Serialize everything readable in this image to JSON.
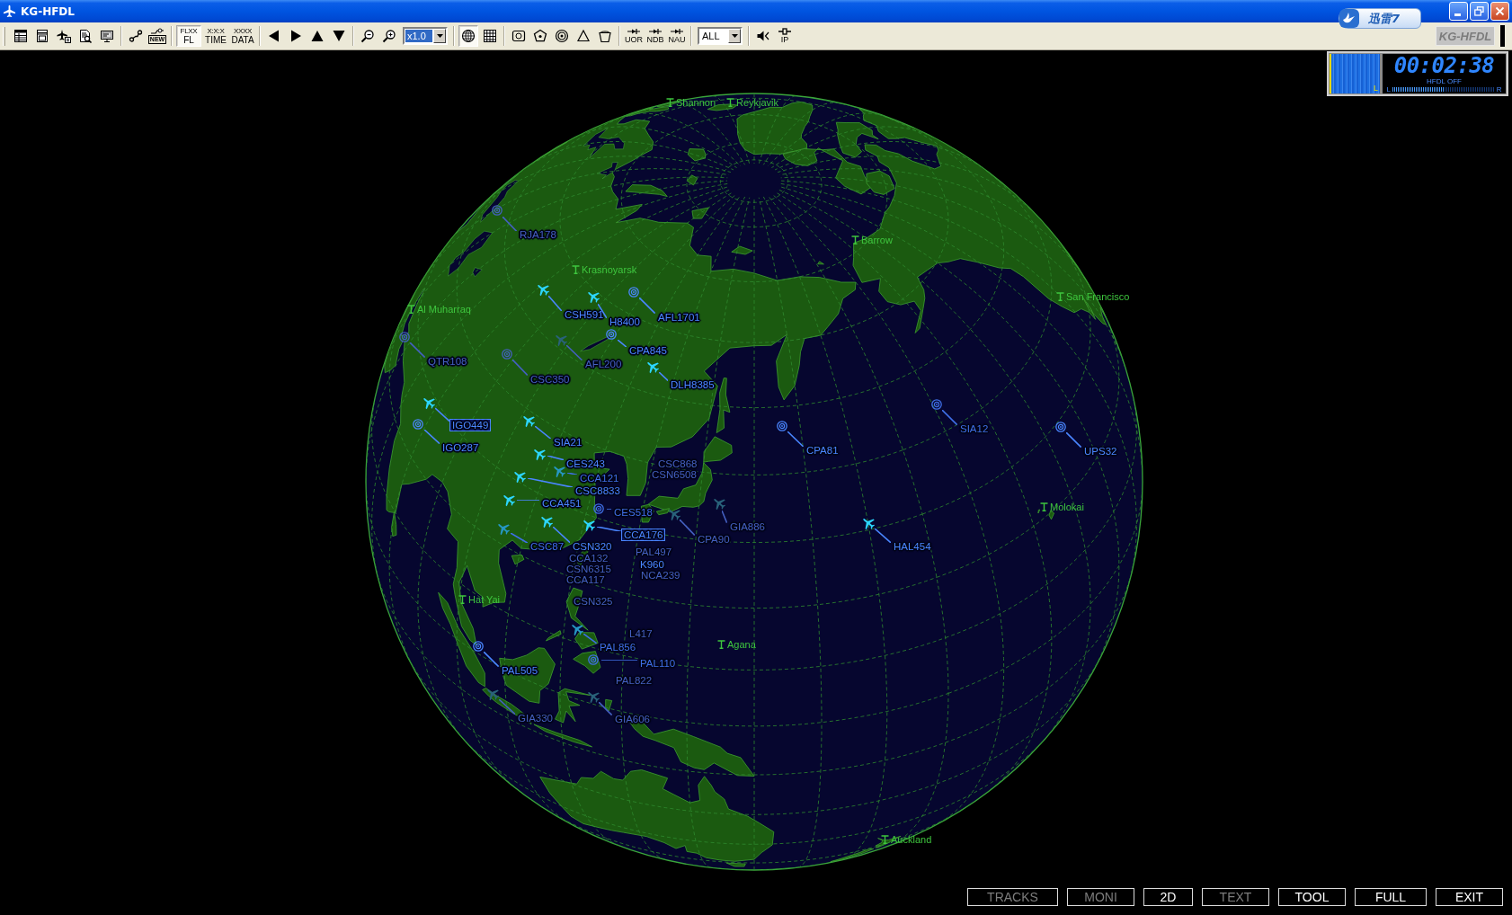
{
  "window": {
    "title": "KG-HFDL"
  },
  "floating_widget": {
    "label": "迅雷7"
  },
  "toolbar": {
    "groups": [
      [
        {
          "kind": "table",
          "pressed": false
        },
        {
          "kind": "window",
          "pressed": false
        },
        {
          "kind": "plane-doc",
          "pressed": false
        },
        {
          "kind": "doc-search",
          "pressed": false
        },
        {
          "kind": "monitor",
          "pressed": false
        }
      ],
      [
        {
          "kind": "connector",
          "pressed": false
        },
        {
          "kind": "new",
          "label": "NEW",
          "pressed": false
        }
      ],
      [
        {
          "kind": "readout",
          "caption": "FLXX",
          "label": "FL",
          "pressed": true
        },
        {
          "kind": "readout",
          "caption": "X:X:X",
          "label": "TIME",
          "pressed": false
        },
        {
          "kind": "readout",
          "caption": "XXXX",
          "label": "DATA",
          "pressed": false
        }
      ],
      [
        {
          "kind": "left",
          "pressed": false
        },
        {
          "kind": "right",
          "pressed": false
        },
        {
          "kind": "up",
          "pressed": false
        },
        {
          "kind": "down",
          "pressed": false
        }
      ],
      [
        {
          "kind": "zoom-out",
          "pressed": false
        },
        {
          "kind": "zoom-in",
          "pressed": false
        },
        {
          "kind": "select",
          "value": "x1.0",
          "focused": true
        }
      ],
      [
        {
          "kind": "globe",
          "pressed": true
        },
        {
          "kind": "grid",
          "pressed": false
        }
      ],
      [
        {
          "kind": "frame",
          "pressed": false
        },
        {
          "kind": "pentagon",
          "pressed": false
        },
        {
          "kind": "rings",
          "pressed": false
        },
        {
          "kind": "triangle",
          "pressed": false
        },
        {
          "kind": "bucket",
          "pressed": false
        }
      ],
      [
        {
          "kind": "beacon",
          "label": "UOR",
          "pressed": false
        },
        {
          "kind": "beacon",
          "label": "NDB",
          "pressed": false
        },
        {
          "kind": "beacon",
          "label": "NAU",
          "pressed": false
        }
      ],
      [
        {
          "kind": "select",
          "value": "ALL",
          "focused": false
        }
      ],
      [
        {
          "kind": "speaker",
          "pressed": false
        },
        {
          "kind": "pin",
          "label": "IP",
          "pressed": false
        }
      ]
    ],
    "logo": "KG-HFDL"
  },
  "receiver": {
    "channel": "L",
    "clock": "00:02:38",
    "status": "HFDL OFF",
    "meter_left": "L",
    "meter_right": "R",
    "level": 0.5
  },
  "map": {
    "stations": [
      {
        "name": "Shannon"
      },
      {
        "name": "Reykjavik"
      },
      {
        "name": "Barrow"
      },
      {
        "name": "San Francisco"
      },
      {
        "name": "Al Muharraq"
      },
      {
        "name": "Krasnoyarsk"
      },
      {
        "name": "Hat Yai"
      },
      {
        "name": "Agana"
      },
      {
        "name": "Molokai"
      },
      {
        "name": "Auckland"
      }
    ],
    "flights": [
      {
        "callsign": "RJA178",
        "kind": "target",
        "color": "#4460c0",
        "boxed": false
      },
      {
        "callsign": "QTR108",
        "kind": "target",
        "color": "#4460c0",
        "boxed": false
      },
      {
        "callsign": "CSH591",
        "kind": "plane",
        "color": "#4a86ff",
        "boxed": false
      },
      {
        "callsign": "H8400",
        "kind": "plane",
        "color": "#4a86ff",
        "boxed": false
      },
      {
        "callsign": "AFL1701",
        "kind": "target",
        "color": "#4a86ff",
        "boxed": false
      },
      {
        "callsign": "CPA845",
        "kind": "target",
        "color": "#4a86ff",
        "boxed": false
      },
      {
        "callsign": "AFL200",
        "kind": "plane",
        "color": "#4460c0",
        "boxed": false
      },
      {
        "callsign": "CSC350",
        "kind": "target",
        "color": "#4460c0",
        "boxed": false
      },
      {
        "callsign": "DLH8385",
        "kind": "plane",
        "color": "#4a86ff",
        "boxed": false
      },
      {
        "callsign": "IGO449",
        "kind": "plane",
        "color": "#4a86ff",
        "boxed": true
      },
      {
        "callsign": "IGO287",
        "kind": "target",
        "color": "#4a86ff",
        "boxed": false
      },
      {
        "callsign": "SIA21",
        "kind": "plane",
        "color": "#4a86ff",
        "boxed": false
      },
      {
        "callsign": "CES243",
        "kind": "plane",
        "color": "#4a86ff",
        "boxed": false
      },
      {
        "callsign": "CCA121",
        "kind": "plane",
        "color": "#3f6fe6",
        "boxed": false
      },
      {
        "callsign": "CSC8833",
        "kind": "plane",
        "color": "#4a86ff",
        "boxed": false
      },
      {
        "callsign": "CCA451",
        "kind": "plane",
        "color": "#4a86ff",
        "boxed": false
      },
      {
        "callsign": "CES518",
        "kind": "target",
        "color": "#3f6fe6",
        "boxed": false
      },
      {
        "callsign": "CCA176",
        "kind": "plane",
        "color": "#4a86ff",
        "boxed": true
      },
      {
        "callsign": "CSC87",
        "kind": "plane",
        "color": "#3f6fe6",
        "boxed": false
      },
      {
        "callsign": "CSN320",
        "kind": "plane",
        "color": "#4a86ff",
        "boxed": false
      },
      {
        "callsign": "PAL497",
        "kind": "tag",
        "color": "#4460c0",
        "boxed": false
      },
      {
        "callsign": "CCA132",
        "kind": "tag",
        "color": "#4460c0",
        "boxed": false
      },
      {
        "callsign": "K960",
        "kind": "tag",
        "color": "#4a86ff",
        "boxed": false
      },
      {
        "callsign": "CSN6315",
        "kind": "tag",
        "color": "#4460c0",
        "boxed": false
      },
      {
        "callsign": "NCA239",
        "kind": "tag",
        "color": "#4460c0",
        "boxed": false
      },
      {
        "callsign": "CCA117",
        "kind": "tag",
        "color": "#4460c0",
        "boxed": false
      },
      {
        "callsign": "CSC868",
        "kind": "tag",
        "color": "#4460c0",
        "boxed": false
      },
      {
        "callsign": "CSN6508",
        "kind": "tag",
        "color": "#4460c0",
        "boxed": false
      },
      {
        "callsign": "GIA886",
        "kind": "plane",
        "color": "#4460c0",
        "boxed": false
      },
      {
        "callsign": "CPA90",
        "kind": "plane",
        "color": "#4460c0",
        "boxed": false
      },
      {
        "callsign": "CSN325",
        "kind": "tag",
        "color": "#4460c0",
        "boxed": false
      },
      {
        "callsign": "L417",
        "kind": "tag",
        "color": "#4460c0",
        "boxed": false
      },
      {
        "callsign": "PAL856",
        "kind": "plane",
        "color": "#3f6fe6",
        "boxed": false
      },
      {
        "callsign": "PAL110",
        "kind": "target",
        "color": "#3f6fe6",
        "boxed": false
      },
      {
        "callsign": "PAL505",
        "kind": "target",
        "color": "#4a86ff",
        "boxed": false
      },
      {
        "callsign": "PAL822",
        "kind": "tag",
        "color": "#4460c0",
        "boxed": false
      },
      {
        "callsign": "GIA330",
        "kind": "plane",
        "color": "#4460c0",
        "boxed": false
      },
      {
        "callsign": "GIA606",
        "kind": "plane",
        "color": "#4460c0",
        "boxed": false
      },
      {
        "callsign": "CPA81",
        "kind": "target",
        "color": "#4a86ff",
        "boxed": false
      },
      {
        "callsign": "SIA12",
        "kind": "target",
        "color": "#3f6fe6",
        "boxed": false
      },
      {
        "callsign": "UPS32",
        "kind": "target",
        "color": "#4a86ff",
        "boxed": false
      },
      {
        "callsign": "HAL454",
        "kind": "plane",
        "color": "#4a86ff",
        "boxed": false
      }
    ]
  },
  "mode_buttons": [
    {
      "label": "TRACKS",
      "enabled": false
    },
    {
      "label": "MONI",
      "enabled": false
    },
    {
      "label": "2D",
      "enabled": true
    },
    {
      "label": "TEXT",
      "enabled": false
    },
    {
      "label": "TOOL",
      "enabled": true
    },
    {
      "label": "FULL",
      "enabled": true
    },
    {
      "label": "EXIT",
      "enabled": true
    }
  ]
}
